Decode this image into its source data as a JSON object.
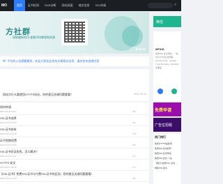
{
  "logo": "MO",
  "nav": [
    "首页",
    "证书检测",
    "DNS诊断",
    "网站测速",
    "域名信息",
    "SSL申请"
  ],
  "banner": {
    "title": "方社群",
    "subtitle": "获取最新资讯  查看代码教程和资源"
  },
  "notice": "平台的公告提醒事项，欢迎大家在此发布文章相关信息，请勿发布违规内容",
  "featured": {
    "title": "网站为什么要使用HTTPS协议，你的意见关键问题要看！",
    "date": "2024-03-19"
  },
  "list": [
    {
      "title": "如何申请",
      "date": "2024-03-20 09:27",
      "meta": "369"
    },
    {
      "title": "SSL证书选择",
      "date": "2024-03-19 14:23",
      "meta": "412"
    },
    {
      "title": "SSL证书安装",
      "date": "2024-03-19 10:18",
      "meta": "278"
    },
    {
      "title": "证书到期续费",
      "date": "2024-03-18 16:55",
      "meta": "356"
    },
    {
      "title": "SSL证书验证失败，怎么解决？",
      "date": "2024-03-18 11:02",
      "meta": "201"
    },
    {
      "title": "HTTPS 安全",
      "date": "2024-03-17 08:40",
      "meta": "197"
    },
    {
      "title": "【SSL证书】免费SSL证书与付费SSL证书的区别，您的意见关键问题要看！",
      "date": "2024-03-16 13:12",
      "meta": "352"
    }
  ],
  "sidebar": {
    "button": "微信",
    "name": "MFSSL",
    "desc": "免费SSL证书申请，一站式HTTPS证书管理，Let's Encrypt、Google Trust Services、ZeroSSL全覆盖",
    "stat_label": "已发表",
    "stat_value": "14985",
    "ad1": "免费申请",
    "ad2": "广告位招租",
    "list_title": "热门排行",
    "list_items": [
      "免费HTTPS是如何",
      "免费SSL证书如何",
      "免费SSL证书申请",
      "免费SSL证书 一站",
      "【官方] 免费SSL 证书...",
      "域名SSL证书"
    ]
  }
}
